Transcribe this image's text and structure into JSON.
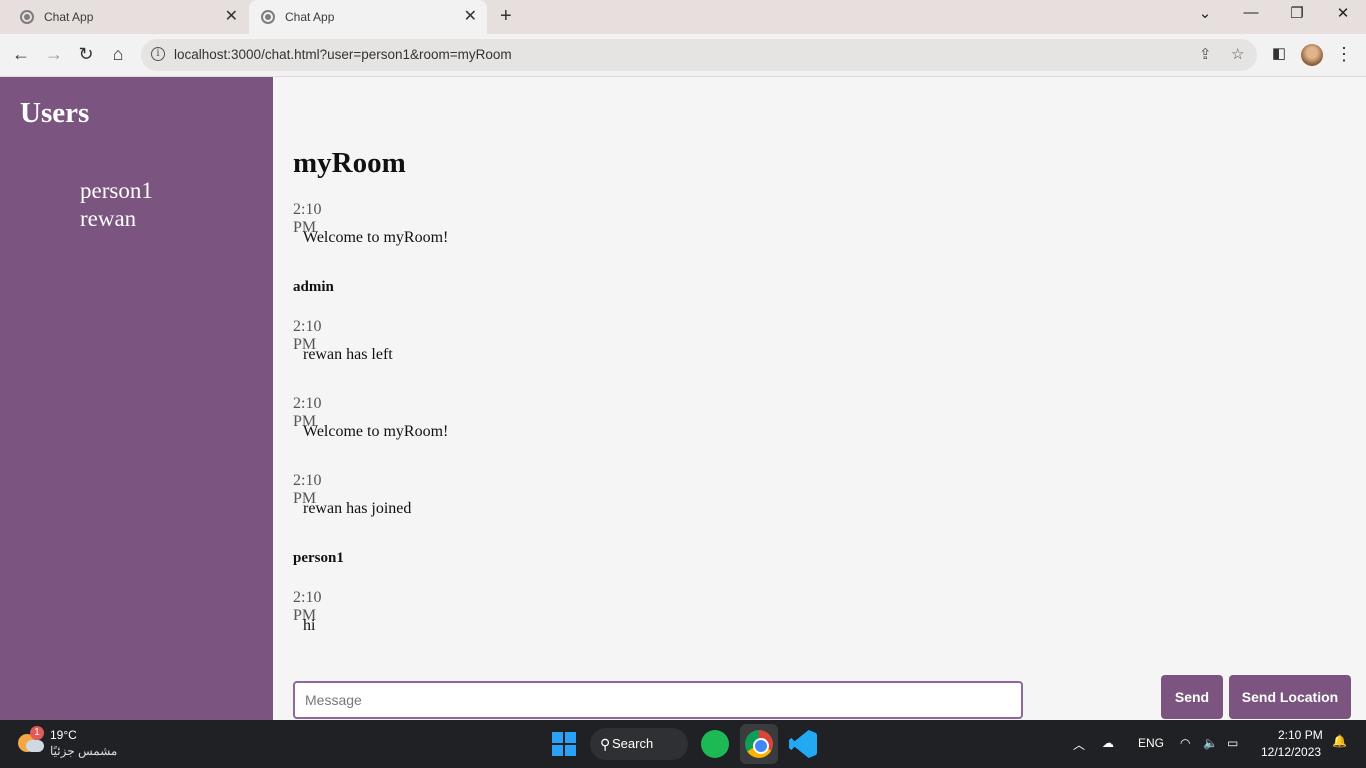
{
  "browser": {
    "tabs": [
      {
        "title": "Chat App",
        "active": false
      },
      {
        "title": "Chat App",
        "active": true
      }
    ],
    "url": "localhost:3000/chat.html?user=person1&room=myRoom"
  },
  "sidebar": {
    "heading": "Users",
    "users": [
      "person1",
      "rewan"
    ],
    "bg_color": "#7b557f"
  },
  "chat": {
    "room_title": "myRoom",
    "messages": [
      {
        "sender": "",
        "time": "2:10 PM",
        "text": "Welcome to myRoom!"
      },
      {
        "sender": "admin",
        "time": "2:10 PM",
        "text": "rewan has left"
      },
      {
        "sender": "",
        "time": "2:10 PM",
        "text": "Welcome to myRoom!"
      },
      {
        "sender": "",
        "time": "2:10 PM",
        "text": "rewan has joined"
      },
      {
        "sender": "person1",
        "time": "2:10 PM",
        "text": "hi"
      }
    ],
    "compose": {
      "placeholder": "Message",
      "value": ""
    },
    "send_label": "Send",
    "send_location_label": "Send Location",
    "accent_color": "#7b557f"
  },
  "taskbar": {
    "weather_badge": "1",
    "temperature": "19°C",
    "condition": "مشمس جزئيًا",
    "search_label": "Search",
    "language": "ENG",
    "time": "2:10 PM",
    "date": "12/12/2023"
  }
}
